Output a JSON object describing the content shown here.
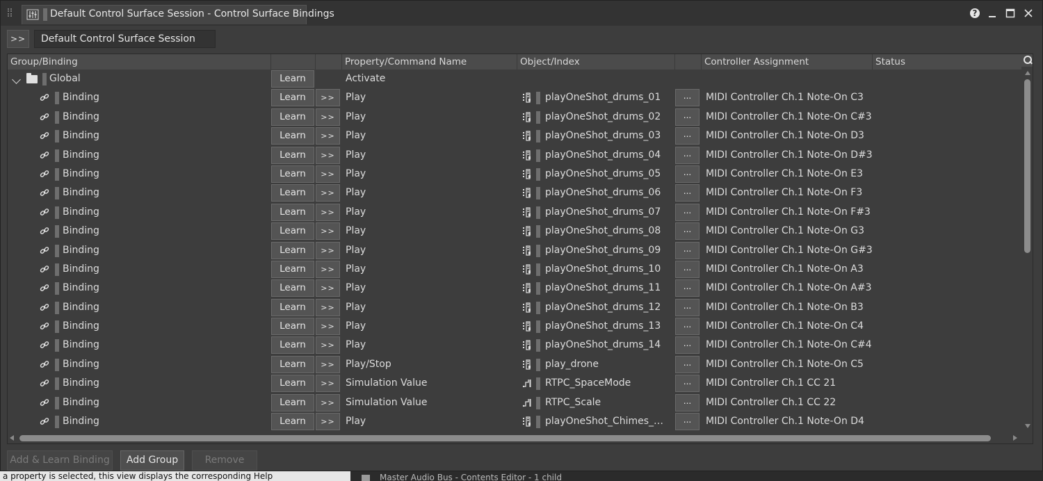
{
  "window": {
    "title": "Default Control Surface Session - Control Surface Bindings",
    "session_name": "Default Control Surface Session",
    "expand_label": ">>",
    "help_label": "?"
  },
  "columns": {
    "group_binding": "Group/Binding",
    "property_command": "Property/Command Name",
    "object_index": "Object/Index",
    "controller_assignment": "Controller Assignment",
    "status": "Status"
  },
  "group": {
    "name": "Global",
    "learn_label": "Learn",
    "property": "Activate"
  },
  "labels": {
    "learn": "Learn",
    "more": ">>",
    "dots": "..."
  },
  "bindings": [
    {
      "name": "Binding",
      "property": "Play",
      "object_type": "event",
      "object": "playOneShot_drums_01",
      "assignment": "MIDI Controller Ch.1 Note-On C3",
      "status": ""
    },
    {
      "name": "Binding",
      "property": "Play",
      "object_type": "event",
      "object": "playOneShot_drums_02",
      "assignment": "MIDI Controller Ch.1 Note-On C#3",
      "status": ""
    },
    {
      "name": "Binding",
      "property": "Play",
      "object_type": "event",
      "object": "playOneShot_drums_03",
      "assignment": "MIDI Controller Ch.1 Note-On D3",
      "status": ""
    },
    {
      "name": "Binding",
      "property": "Play",
      "object_type": "event",
      "object": "playOneShot_drums_04",
      "assignment": "MIDI Controller Ch.1 Note-On D#3",
      "status": ""
    },
    {
      "name": "Binding",
      "property": "Play",
      "object_type": "event",
      "object": "playOneShot_drums_05",
      "assignment": "MIDI Controller Ch.1 Note-On E3",
      "status": ""
    },
    {
      "name": "Binding",
      "property": "Play",
      "object_type": "event",
      "object": "playOneShot_drums_06",
      "assignment": "MIDI Controller Ch.1 Note-On F3",
      "status": ""
    },
    {
      "name": "Binding",
      "property": "Play",
      "object_type": "event",
      "object": "playOneShot_drums_07",
      "assignment": "MIDI Controller Ch.1 Note-On F#3",
      "status": ""
    },
    {
      "name": "Binding",
      "property": "Play",
      "object_type": "event",
      "object": "playOneShot_drums_08",
      "assignment": "MIDI Controller Ch.1 Note-On G3",
      "status": ""
    },
    {
      "name": "Binding",
      "property": "Play",
      "object_type": "event",
      "object": "playOneShot_drums_09",
      "assignment": "MIDI Controller Ch.1 Note-On G#3",
      "status": ""
    },
    {
      "name": "Binding",
      "property": "Play",
      "object_type": "event",
      "object": "playOneShot_drums_10",
      "assignment": "MIDI Controller Ch.1 Note-On A3",
      "status": ""
    },
    {
      "name": "Binding",
      "property": "Play",
      "object_type": "event",
      "object": "playOneShot_drums_11",
      "assignment": "MIDI Controller Ch.1 Note-On A#3",
      "status": ""
    },
    {
      "name": "Binding",
      "property": "Play",
      "object_type": "event",
      "object": "playOneShot_drums_12",
      "assignment": "MIDI Controller Ch.1 Note-On B3",
      "status": ""
    },
    {
      "name": "Binding",
      "property": "Play",
      "object_type": "event",
      "object": "playOneShot_drums_13",
      "assignment": "MIDI Controller Ch.1 Note-On C4",
      "status": ""
    },
    {
      "name": "Binding",
      "property": "Play",
      "object_type": "event",
      "object": "playOneShot_drums_14",
      "assignment": "MIDI Controller Ch.1 Note-On C#4",
      "status": ""
    },
    {
      "name": "Binding",
      "property": "Play/Stop",
      "object_type": "event",
      "object": "play_drone",
      "assignment": "MIDI Controller Ch.1 Note-On C5",
      "status": ""
    },
    {
      "name": "Binding",
      "property": "Simulation Value",
      "object_type": "rtpc",
      "object": "RTPC_SpaceMode",
      "assignment": "MIDI Controller Ch.1 CC 21",
      "status": ""
    },
    {
      "name": "Binding",
      "property": "Simulation Value",
      "object_type": "rtpc",
      "object": "RTPC_Scale",
      "assignment": "MIDI Controller Ch.1 CC 22",
      "status": ""
    },
    {
      "name": "Binding",
      "property": "Play",
      "object_type": "event",
      "object": "playOneShot_Chimes_Meta...",
      "assignment": "MIDI Controller Ch.1 Note-On D4",
      "status": ""
    }
  ],
  "footer": {
    "add_learn_label": "Add & Learn Binding",
    "add_group_label": "Add Group",
    "remove_label": "Remove"
  },
  "background": {
    "left_text": "a property is selected, this view displays the corresponding Help",
    "right_text": "Master Audio Bus - Contents Editor - 1 child"
  }
}
